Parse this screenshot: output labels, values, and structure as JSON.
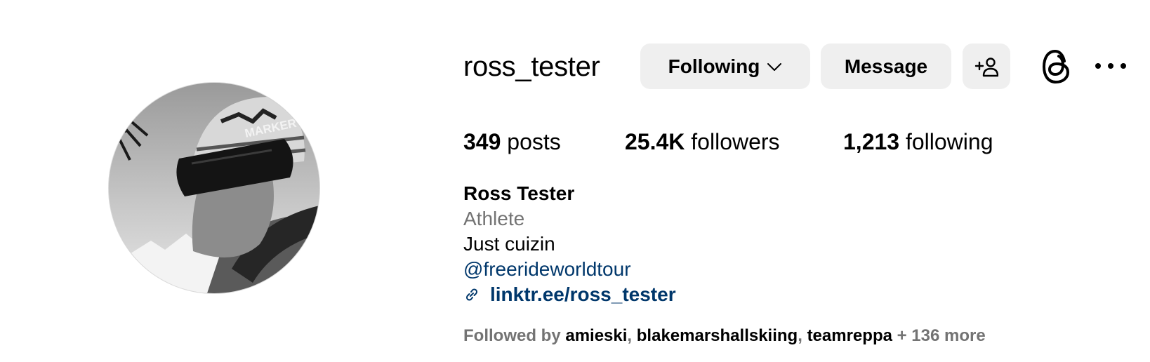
{
  "profile": {
    "username": "ross_tester",
    "display_name": "Ross Tester",
    "category": "Athlete",
    "bio": "Just cuizin",
    "mention": "@freerideworldtour",
    "link": "linktr.ee/ross_tester"
  },
  "buttons": {
    "following": "Following",
    "message": "Message"
  },
  "stats": {
    "posts_count": "349",
    "posts_label": "posts",
    "followers_count": "25.4K",
    "followers_label": "followers",
    "following_count": "1,213",
    "following_label": "following"
  },
  "followed_by": {
    "prefix": "Followed by",
    "users": [
      "amieski",
      "blakemarshallskiing",
      "teamreppa"
    ],
    "sep": ",",
    "more": "+ 136 more"
  },
  "avatar": {
    "beanie_text": "MARKER"
  },
  "icons": {
    "following_chevron": "chevron-down-icon",
    "add": "add-person-icon",
    "threads": "threads-icon",
    "more": "more-icon",
    "link": "link-icon"
  },
  "colors": {
    "button_bg": "#efefef",
    "link": "#00376b",
    "secondary_text": "#737373"
  }
}
